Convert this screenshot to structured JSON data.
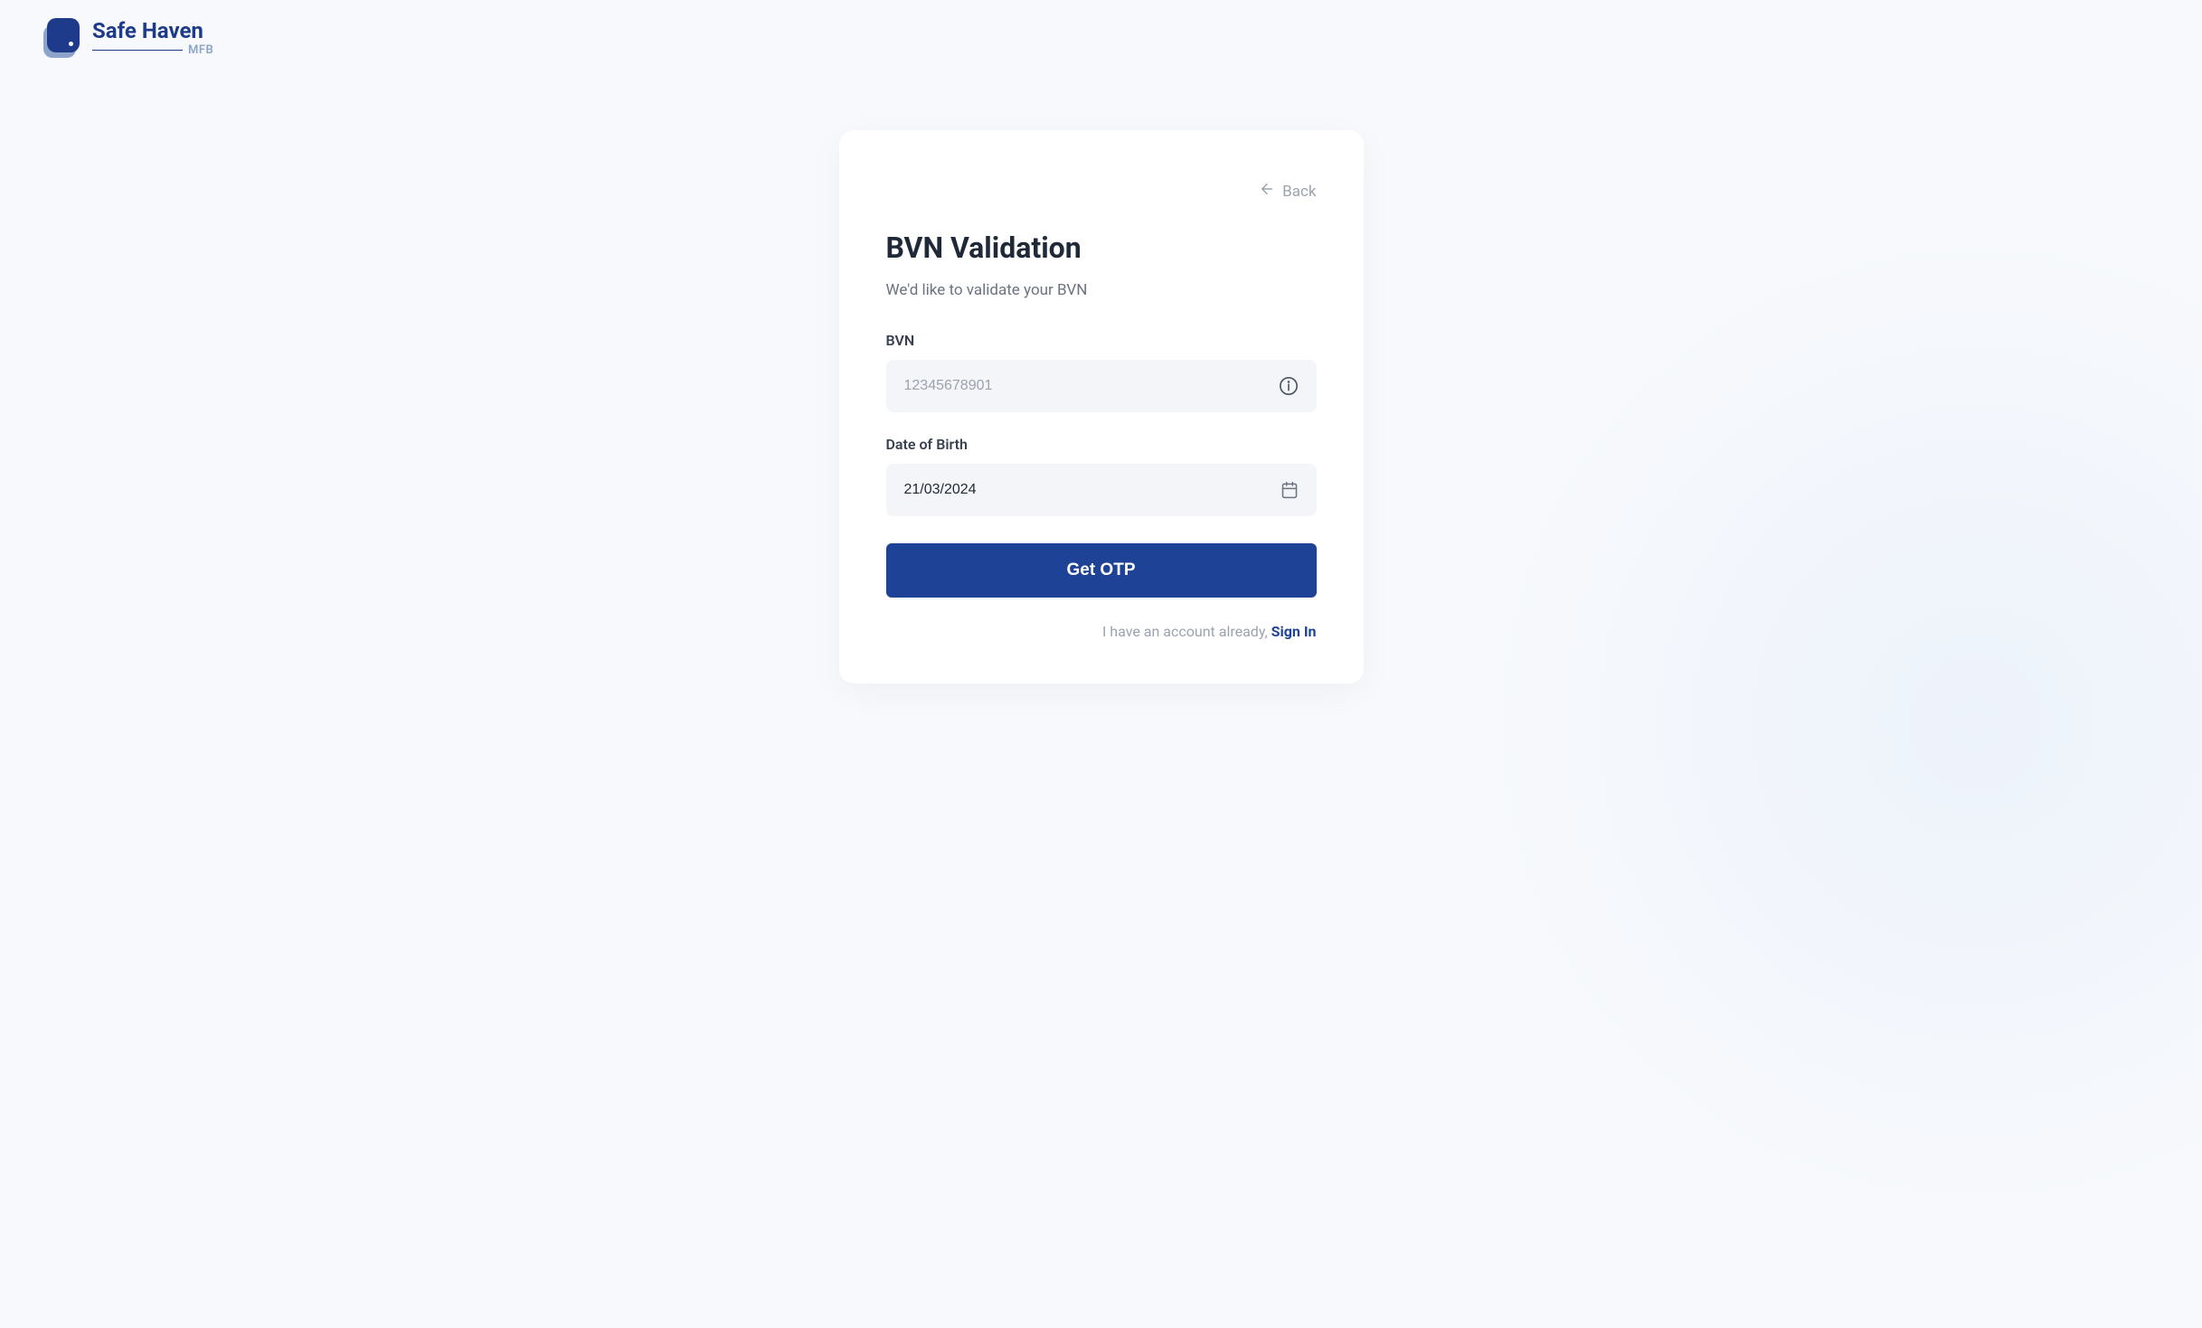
{
  "logo": {
    "brand": "Safe Haven",
    "sub": "MFB"
  },
  "card": {
    "back_label": "Back",
    "title": "BVN Validation",
    "subtitle": "We'd like to validate your BVN",
    "fields": {
      "bvn": {
        "label": "BVN",
        "placeholder": "12345678901"
      },
      "dob": {
        "label": "Date of Birth",
        "value": "21/03/2024"
      }
    },
    "button": "Get OTP",
    "footer": {
      "text": "I have an account already, ",
      "link": "Sign In"
    }
  }
}
